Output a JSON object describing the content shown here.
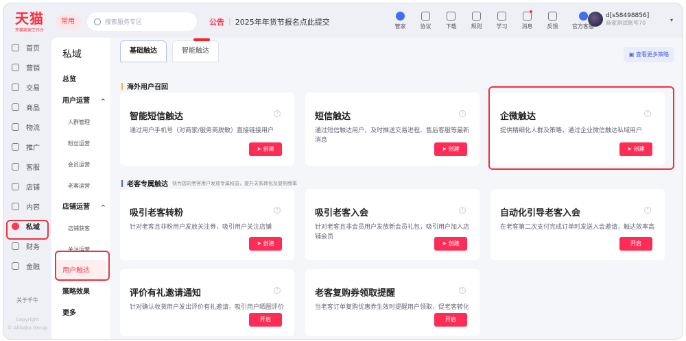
{
  "header": {
    "logo": "天猫",
    "logo_sub": "天猫商家工作台",
    "common": "常用",
    "search_placeholder": "搜索服务专区",
    "notice_label": "公告",
    "notice_text": "2025年年货节报名点此提交",
    "tools": [
      {
        "label": "管家",
        "icon": "butler-icon"
      },
      {
        "label": "协议",
        "icon": "agreement-icon"
      },
      {
        "label": "下载",
        "icon": "download-icon"
      },
      {
        "label": "规则",
        "icon": "rules-icon"
      },
      {
        "label": "学习",
        "icon": "learn-icon"
      },
      {
        "label": "消息",
        "icon": "message-icon"
      },
      {
        "label": "反馈",
        "icon": "feedback-icon"
      },
      {
        "label": "官方客服",
        "icon": "support-icon"
      }
    ],
    "user_name": "d[s58498856]",
    "user_sub": "商家测试账号70"
  },
  "nav": {
    "items": [
      "首页",
      "营销",
      "交易",
      "商品",
      "物流",
      "推广",
      "客服",
      "店铺",
      "内容",
      "私域",
      "财务",
      "金融"
    ],
    "active": "私域",
    "about": "关于千牛",
    "copyright": "Copyright",
    "copyright2": "© Alibaba Group"
  },
  "subnav": {
    "title": "私域",
    "items": [
      {
        "label": "总览",
        "type": "group"
      },
      {
        "label": "用户运营",
        "type": "group",
        "caret": "^"
      },
      {
        "label": "人群管理",
        "type": "sub"
      },
      {
        "label": "粉丝运营",
        "type": "sub"
      },
      {
        "label": "会员运营",
        "type": "sub"
      },
      {
        "label": "老客运营",
        "type": "sub"
      },
      {
        "label": "店铺运营",
        "type": "group",
        "caret": "^"
      },
      {
        "label": "店铺获客",
        "type": "sub"
      },
      {
        "label": "关注运营",
        "type": "sub"
      },
      {
        "label": "用户触达",
        "type": "active"
      },
      {
        "label": "策略效果",
        "type": "group"
      },
      {
        "label": "更多",
        "type": "group"
      }
    ]
  },
  "main": {
    "tabs": [
      "基础触达",
      "智能触达"
    ],
    "more": "查看更多策略",
    "sections": [
      {
        "title": "海外用户召回",
        "desc": "",
        "color": "#f5b041"
      },
      {
        "title": "老客专属触达",
        "desc": "快为您的老客用户发放专属权益，提升关系转化及复购频率",
        "color": "#4a63d8"
      }
    ],
    "cards": [
      {
        "title": "智能短信触达",
        "desc": "通过用户手机号（对商家/服务商脱敏）直接链接用户",
        "button": "创建"
      },
      {
        "title": "短信触达",
        "desc": "通过短信触达用户，及时推送交易进程、售后客服等最新消息",
        "button": "创建"
      },
      {
        "title": "企微触达",
        "desc": "提供精细化人群及策略，通过企业微信触达私域用户",
        "button": "创建"
      },
      {
        "title": "吸引老客转粉",
        "desc": "针对老客且非粉用户发放关注券，吸引用户关注店铺",
        "button": "创建"
      },
      {
        "title": "吸引老客入会",
        "desc": "针对老客且非会员用户发放新会员礼包，吸引用户加入店铺会员",
        "button": "创建"
      },
      {
        "title": "自动化引导老客入会",
        "desc": "在老客第二次支付完成订单时发送入会邀请，触达效率高",
        "button": "开启"
      },
      {
        "title": "评价有礼邀请通知",
        "desc": "针对确认收货用户发出评价有礼邀请，吸引用户晒图评价",
        "button": "开启"
      },
      {
        "title": "老客复购券领取提醒",
        "desc": "当老客订单复购优惠券生效时提醒用户领取，促老客转化",
        "button": "开启"
      }
    ],
    "help_icon": "?"
  }
}
